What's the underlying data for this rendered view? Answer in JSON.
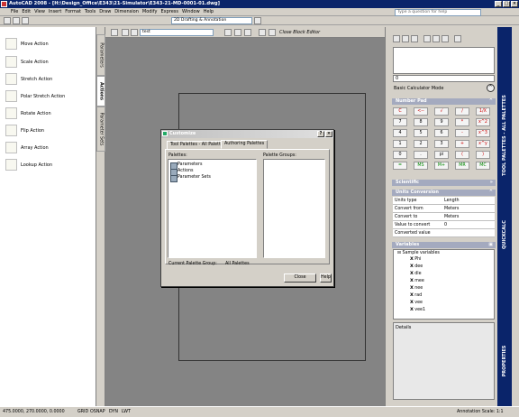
{
  "window": {
    "title": "AutoCAD 2008 - [H:\\Design_Office\\E343\\21-Simulator\\E343-21-MD-0001-01.dwg]",
    "controls": [
      "_",
      "□",
      "×"
    ]
  },
  "menu": {
    "items": [
      "File",
      "Edit",
      "View",
      "Insert",
      "Format",
      "Tools",
      "Draw",
      "Dimension",
      "Modify",
      "Express",
      "Window",
      "Help"
    ],
    "help_placeholder": "Type a question for help"
  },
  "toolbar": {
    "workspace": "2D Drafting & Annotation"
  },
  "block_editor": {
    "name_field": "test",
    "close_label": "Close Block Editor"
  },
  "left_palette": {
    "items": [
      {
        "label": "Move Action",
        "icon": "move-action-icon"
      },
      {
        "label": "Scale Action",
        "icon": "scale-action-icon"
      },
      {
        "label": "Stretch Action",
        "icon": "stretch-action-icon"
      },
      {
        "label": "Polar Stretch Action",
        "icon": "polar-stretch-action-icon"
      },
      {
        "label": "Rotate Action",
        "icon": "rotate-action-icon"
      },
      {
        "label": "Flip Action",
        "icon": "flip-action-icon"
      },
      {
        "label": "Array Action",
        "icon": "array-action-icon"
      },
      {
        "label": "Lookup Action",
        "icon": "lookup-action-icon"
      }
    ],
    "tabs": [
      "Parameters",
      "Actions",
      "Parameter Sets"
    ]
  },
  "dialog": {
    "title": "Customize",
    "help_q": "?",
    "tabs": [
      "Tool Palettes - All Palettes",
      "Authoring Palettes"
    ],
    "palettes_label": "Palettes:",
    "groups_label": "Palette Groups:",
    "palettes": [
      "Parameters",
      "Actions",
      "Parameter Sets"
    ],
    "current_group_label": "Current Palette Group:",
    "current_group_value": "All Palettes",
    "close_button": "Close",
    "help_button": "Help"
  },
  "calculator": {
    "display": "0",
    "mode": "Basic Calculator Mode",
    "number_pad_title": "Number Pad",
    "keys": [
      [
        "C",
        "<--",
        "√",
        "/",
        "1/X"
      ],
      [
        "7",
        "8",
        "9",
        "*",
        "x^2"
      ],
      [
        "4",
        "5",
        "6",
        "-",
        "x^3"
      ],
      [
        "1",
        "2",
        "3",
        "+",
        "x^y"
      ],
      [
        "0",
        ".",
        "pi",
        "(",
        ")"
      ],
      [
        "=",
        "MS",
        "M+",
        "MR",
        "MC"
      ]
    ],
    "scientific_title": "Scientific",
    "units_title": "Units Conversion",
    "units": [
      [
        "Units type",
        "Length"
      ],
      [
        "Convert from",
        "Meters"
      ],
      [
        "Convert to",
        "Meters"
      ],
      [
        "Value to convert",
        "0"
      ],
      [
        "Converted value",
        ""
      ]
    ],
    "variables_title": "Variables",
    "variables_root": "Sample variables",
    "variables": [
      "Phi",
      "dee",
      "dle",
      "mee",
      "nee",
      "rad",
      "vee",
      "vee1"
    ],
    "details_label": "Details"
  },
  "right_bar": {
    "tool_palettes": "TOOL PALETTES - ALL PALETTES",
    "quickcalc": "QUICKCALC",
    "properties": "PROPERTIES"
  },
  "status": {
    "coords": "475.0000, 270.0000, 0.0000",
    "toggles": [
      "GRID",
      "OSNAP",
      "DYN",
      "LWT"
    ],
    "annotation_scale": "Annotation Scale: 1:1"
  }
}
